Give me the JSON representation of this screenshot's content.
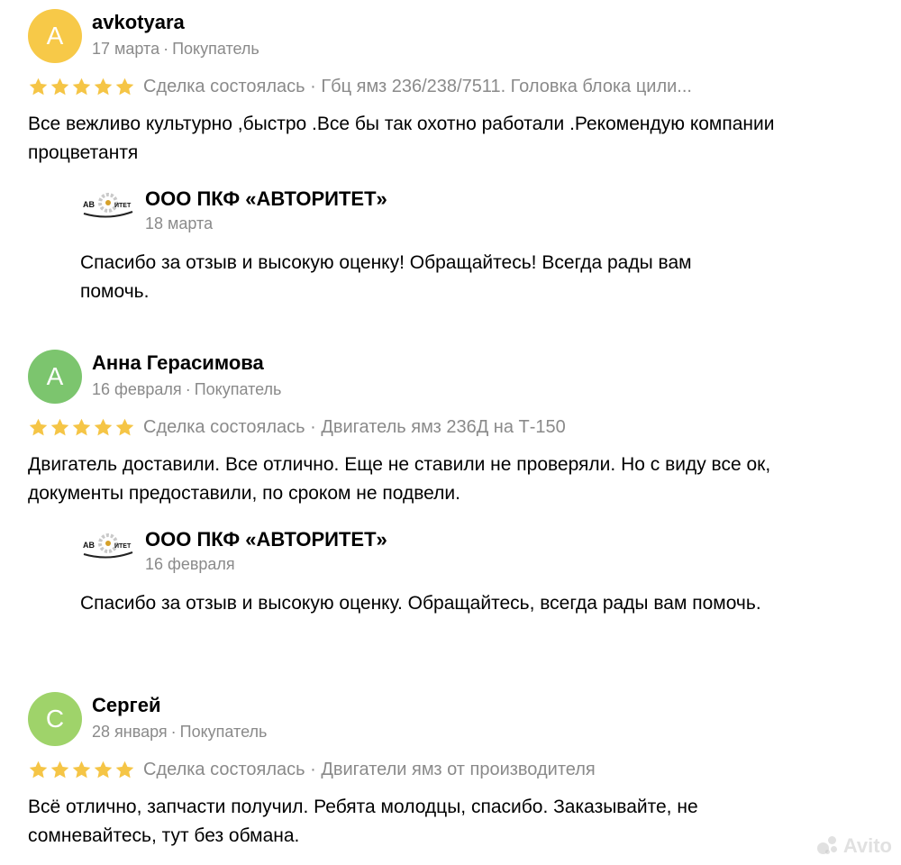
{
  "colors": {
    "star": "#f5c546",
    "meta": "#8a8a8a",
    "avatar_a1": "#f7c948",
    "avatar_a2": "#7cc56e",
    "avatar_c": "#9fd36a"
  },
  "reviews": [
    {
      "avatar_letter": "A",
      "author": "avkotyara",
      "date": "17 марта",
      "role": "Покупатель",
      "stars": 5,
      "deal": "Сделка состоялась · Гбц ямз 236/238/7511. Головка блока цили...",
      "text": "Все вежливо культурно ,быстро .Все бы так охотно работали .Рекомендую компании процветантя",
      "reply": {
        "company": "ООО ПКФ «АВТОРИТЕТ»",
        "date": "18 марта",
        "text": "Спасибо за отзыв и высокую оценку! Обращайтесь! Всегда рады вам помочь."
      }
    },
    {
      "avatar_letter": "А",
      "author": "Анна Герасимова",
      "date": "16 февраля",
      "role": "Покупатель",
      "stars": 5,
      "deal": "Сделка состоялась · Двигатель ямз 236Д на Т-150",
      "text": "Двигатель доставили. Все отлично. Еще не ставили не проверяли. Но с виду все ок, документы предоставили, по сроком не подвели.",
      "reply": {
        "company": "ООО ПКФ «АВТОРИТЕТ»",
        "date": "16 февраля",
        "text": "Спасибо за отзыв и высокую оценку. Обращайтесь, всегда рады вам помочь."
      }
    },
    {
      "avatar_letter": "С",
      "author": "Сергей",
      "date": "28 января",
      "role": "Покупатель",
      "stars": 5,
      "deal": "Сделка состоялась · Двигатели ямз от производителя",
      "text": "Всё отлично, запчасти получил. Ребята молодцы, спасибо. Заказывайте, не сомневайтесь, тут без обмана."
    }
  ],
  "logo_text": "АВТОРИТЕТ",
  "watermark": "Avito"
}
